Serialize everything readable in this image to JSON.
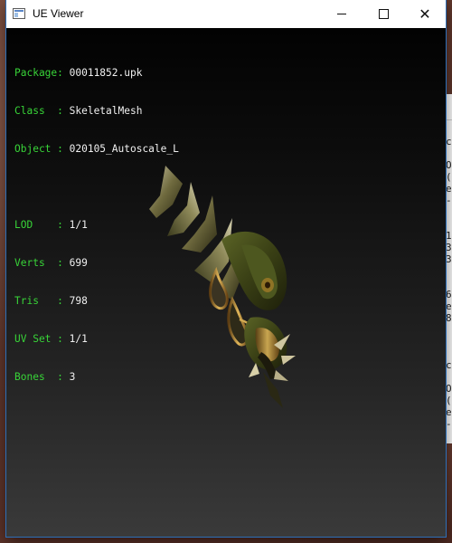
{
  "window": {
    "title": "UE Viewer",
    "controls": {
      "minimize": "—",
      "maximize": "□",
      "close": "✕"
    }
  },
  "info": {
    "package": {
      "label": "Package: ",
      "value": "00011852.upk"
    },
    "class": {
      "label": "Class  : ",
      "value": "SkeletalMesh"
    },
    "object": {
      "label": "Object : ",
      "value": "020105_Autoscale_L"
    },
    "lod": {
      "label": "LOD    : ",
      "value": "1/1"
    },
    "verts": {
      "label": "Verts  : ",
      "value": "699"
    },
    "tris": {
      "label": "Tris   : ",
      "value": "798"
    },
    "uvset": {
      "label": "UV Set : ",
      "value": "1/1"
    },
    "bones": {
      "label": "Bones  : ",
      "value": "3"
    }
  },
  "background_window": {
    "lines": [
      "c",
      "",
      "O",
      "(",
      "e",
      "-",
      "",
      "",
      "1",
      "3",
      "3",
      "",
      "",
      "6",
      "e",
      "8",
      "",
      "",
      "",
      "c",
      "",
      "O",
      "(",
      "e",
      "-"
    ]
  },
  "colors": {
    "label_green": "#38d438",
    "value_white": "#f0f0f0",
    "window_border": "#2d6fb8"
  },
  "icons": {
    "app": "app-window-icon",
    "minimize": "minimize-icon",
    "maximize": "maximize-icon",
    "close": "close-icon"
  }
}
